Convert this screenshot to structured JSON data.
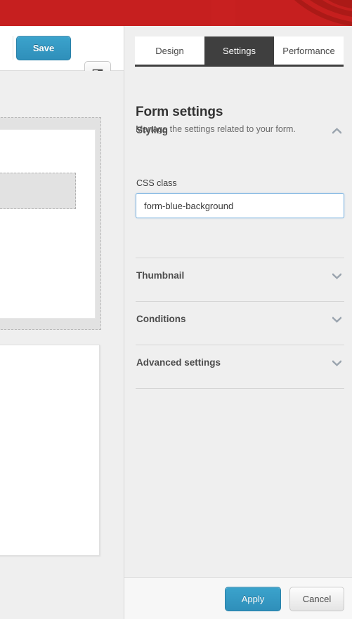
{
  "banner": {
    "color": "#c61f1f"
  },
  "left_panel": {
    "toolbar": {
      "save_label": "Save",
      "layout_toggle_name": "layout-panel-icon"
    }
  },
  "right_panel": {
    "tabs": [
      {
        "label": "Design",
        "active": false
      },
      {
        "label": "Settings",
        "active": true
      },
      {
        "label": "Performance",
        "active": false
      }
    ],
    "title": "Form settings",
    "subtitle": "Manage the settings related to your form.",
    "sections": [
      {
        "label": "Styling",
        "expanded": true,
        "chevron": "chevron-up-icon"
      },
      {
        "label": "Thumbnail",
        "expanded": false,
        "chevron": "chevron-down-icon"
      },
      {
        "label": "Conditions",
        "expanded": false,
        "chevron": "chevron-down-icon"
      },
      {
        "label": "Advanced settings",
        "expanded": false,
        "chevron": "chevron-down-icon"
      }
    ],
    "css_class_field": {
      "label": "CSS class",
      "value": "form-blue-background",
      "placeholder": ""
    }
  },
  "footer": {
    "apply_label": "Apply",
    "cancel_label": "Cancel"
  },
  "colors": {
    "banner_red": "#c61f1f",
    "primary_blue": "#2f8fba",
    "tab_active_bg": "#3f3f3f",
    "panel_bg": "#efefef",
    "input_focus_border": "#7cb3e0"
  }
}
